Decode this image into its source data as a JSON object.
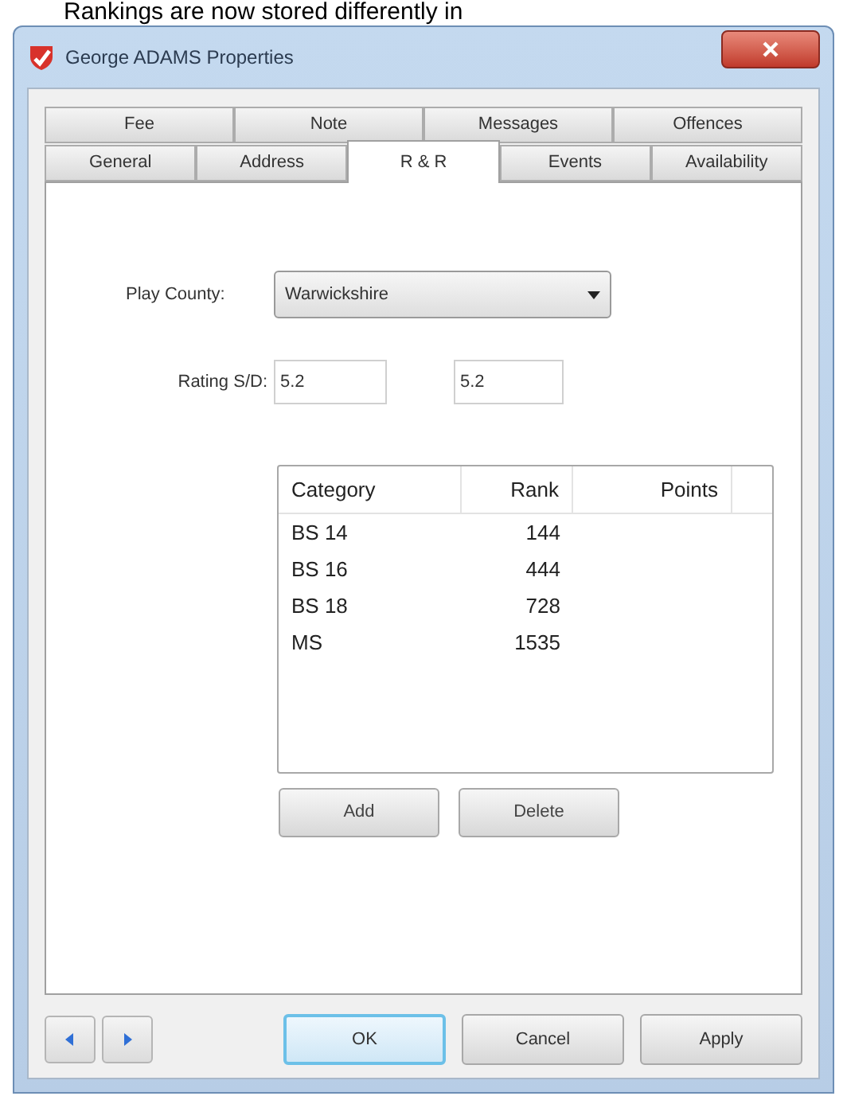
{
  "caption": "Rankings are now stored differently in",
  "window": {
    "title": "George ADAMS Properties"
  },
  "tab_rows": [
    [
      {
        "label": "Fee",
        "selected": false
      },
      {
        "label": "Note",
        "selected": false
      },
      {
        "label": "Messages",
        "selected": false
      },
      {
        "label": "Offences",
        "selected": false
      }
    ],
    [
      {
        "label": "General",
        "selected": false
      },
      {
        "label": "Address",
        "selected": false
      },
      {
        "label": "R & R",
        "selected": true
      },
      {
        "label": "Events",
        "selected": false
      },
      {
        "label": "Availability",
        "selected": false
      }
    ]
  ],
  "play_county": {
    "label": "Play County:",
    "value": "Warwickshire"
  },
  "rating": {
    "label": "Rating S/D:",
    "single": "5.2",
    "double": "5.2"
  },
  "table": {
    "columns": [
      "Category",
      "Rank",
      "Points"
    ],
    "rows": [
      [
        "BS 14",
        "144",
        ""
      ],
      [
        "BS 16",
        "444",
        ""
      ],
      [
        "BS 18",
        "728",
        ""
      ],
      [
        "MS",
        "1535",
        ""
      ]
    ]
  },
  "list_buttons": [
    "Add",
    "Delete"
  ],
  "dialog_buttons": [
    {
      "label": "OK",
      "default": true
    },
    {
      "label": "Cancel",
      "default": false
    },
    {
      "label": "Apply",
      "default": false
    }
  ]
}
